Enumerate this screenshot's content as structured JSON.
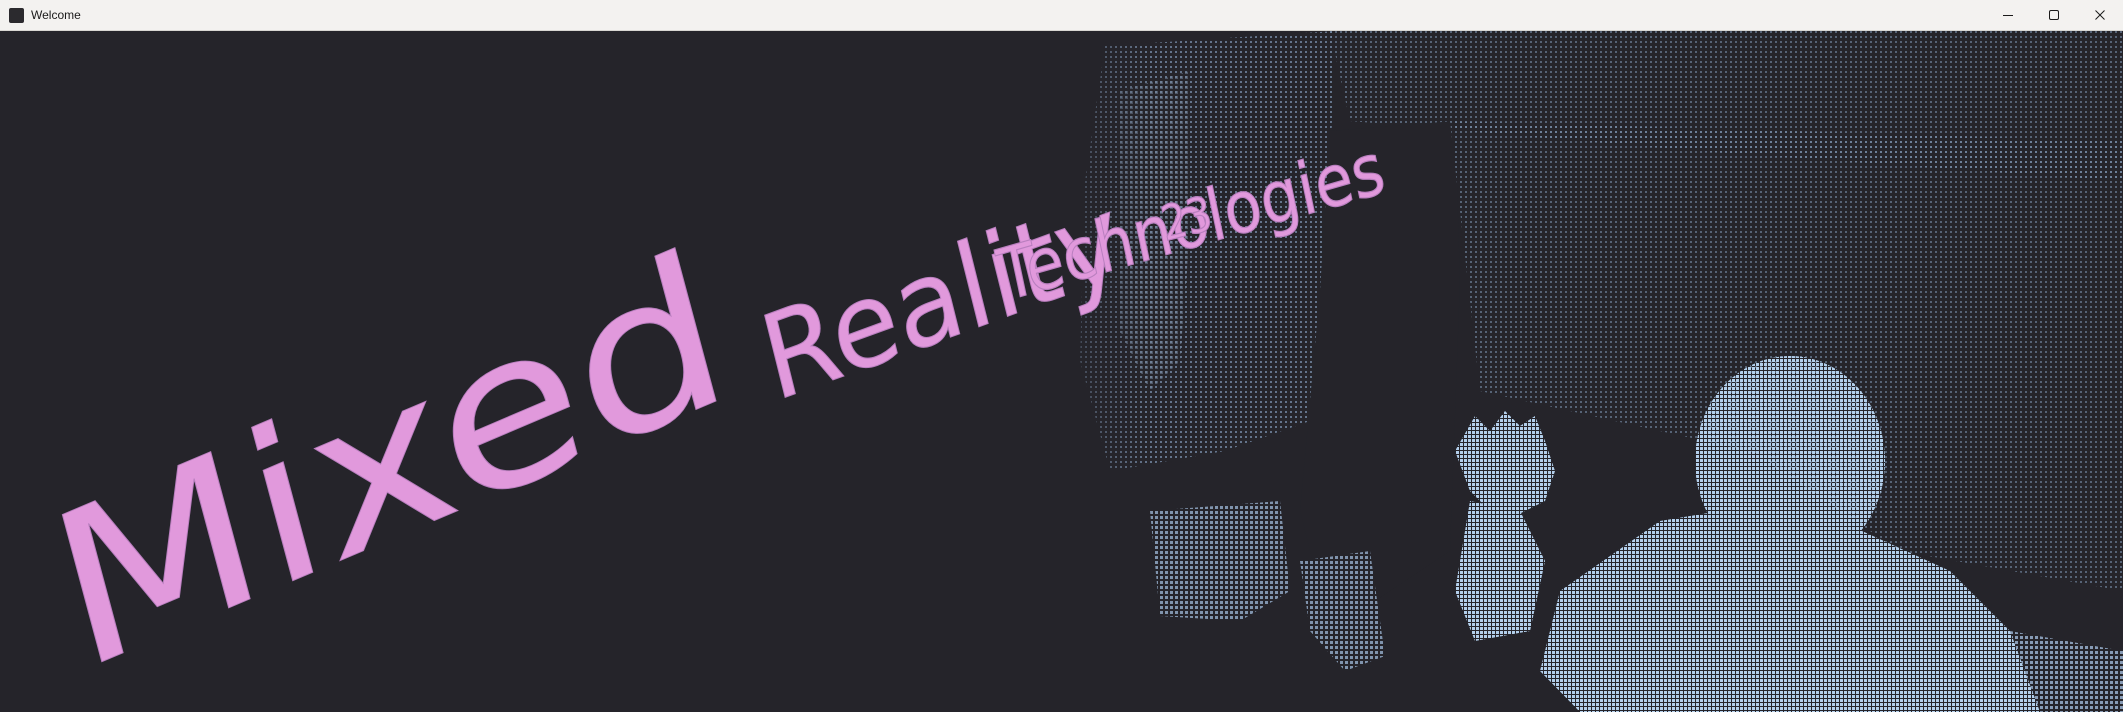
{
  "window": {
    "title": "Welcome",
    "app_icon": "app-window-icon",
    "controls": {
      "minimize_icon": "minimize-icon",
      "maximize_icon": "maximize-icon",
      "close_icon": "close-icon"
    }
  },
  "scene": {
    "background_color": "#25242a",
    "point_cloud_color": "#a9c6e6",
    "text_color": "#e199dc",
    "heading": {
      "word1": "Mixed",
      "word2": "Reality",
      "word3": "Technologies",
      "word4": "23"
    }
  }
}
